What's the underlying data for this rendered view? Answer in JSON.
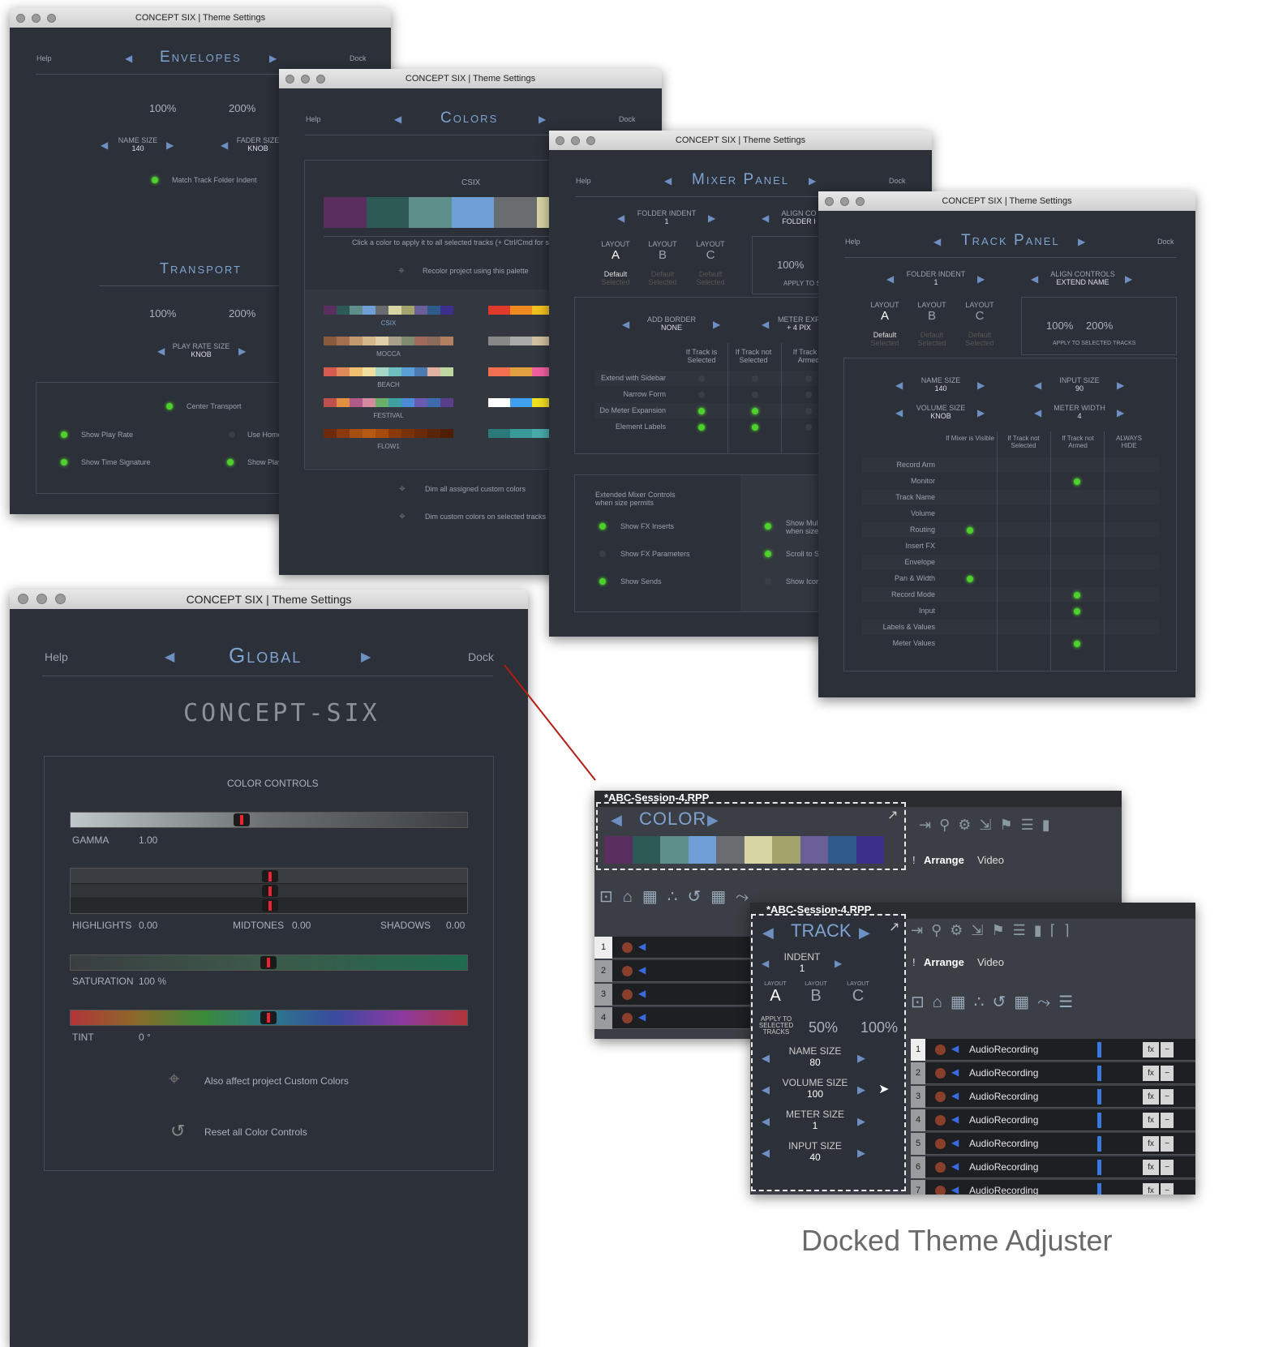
{
  "window_title": "CONCEPT SIX | Theme Settings",
  "common": {
    "help": "Help",
    "dock": "Dock",
    "prev": "◀",
    "next": "▶"
  },
  "envelopes": {
    "title": "Envelopes",
    "p100": "100%",
    "p200": "200%",
    "name_size_label": "NAME SIZE",
    "name_size_val": "140",
    "fader_size_label": "FADER SIZE",
    "fader_size_val": "KNOB",
    "match_track": "Match Track Folder Indent",
    "transport_title": "Transport",
    "t100": "100%",
    "t200": "200%",
    "play_rate_label": "PLAY RATE SIZE",
    "play_rate_val": "KNOB",
    "center_transport": "Center Transport",
    "show_play_rate": "Show Play Rate",
    "use_home": "Use Home",
    "show_time_sig": "Show Time Signature",
    "show_play": "Show Play"
  },
  "colors": {
    "title": "Colors",
    "palette_name": "CSIX",
    "palette": [
      "#5a2e5e",
      "#2e5a56",
      "#5e8f8a",
      "#6f9fd6",
      "#6a6d70",
      "#d6d5a3",
      "#a3a36c",
      "#6b5f9a"
    ],
    "click_hint": "Click a color to apply it to all selected tracks  (+ Ctrl/Cmd for se",
    "recolor": "Recolor project using this palette",
    "palettes": [
      {
        "name": "CSIX",
        "colors": [
          "#5a2e5e",
          "#2e5a56",
          "#5e8f8a",
          "#6f9fd6",
          "#6a6d70",
          "#d6d5a3",
          "#a3a36c",
          "#6b5f9a",
          "#2f5b8a",
          "#3a2f8a"
        ]
      },
      {
        "name": "MOCCA",
        "colors": [
          "#8a5a3e",
          "#a36f4f",
          "#c29a6e",
          "#d6b98a",
          "#e0cfa6",
          "#a8a08a",
          "#7f8a6e",
          "#a06a5a",
          "#8a6a5a",
          "#b08060"
        ]
      },
      {
        "name": "BEACH",
        "colors": [
          "#d65a4e",
          "#e08a5a",
          "#f0c070",
          "#f0e0a0",
          "#a6d6c6",
          "#6ec0c0",
          "#5aa0d6",
          "#4a7ab0",
          "#e0b0a0",
          "#c0d6a0"
        ]
      },
      {
        "name": "FESTIVAL",
        "colors": [
          "#c0504e",
          "#e0903e",
          "#b05a8a",
          "#d68aa0",
          "#6ab06a",
          "#3ea0a0",
          "#4a8ad6",
          "#6a5ab0",
          "#3e6ab0",
          "#5a3e8a"
        ]
      },
      {
        "name": "FLOW1",
        "colors": [
          "#6e2a0a",
          "#8a3a0e",
          "#a64e12",
          "#b65a14",
          "#a64a0e",
          "#8a3a0a",
          "#7a320a",
          "#6a2a08",
          "#5a2406",
          "#4e1e04"
        ]
      }
    ],
    "palettes_right": [
      [
        "#e03a2a",
        "#f08a20",
        "#f0c020",
        "#60c040",
        "#30a0d0",
        "#3060c0",
        "#8040c0",
        "#c04090"
      ],
      [
        "#888",
        "#aaa",
        "#d0c0a0",
        "#b0d0c0",
        "#c0a080",
        "#a0a0b0",
        "#909090",
        "#707070"
      ],
      [
        "#f07050",
        "#e0a040",
        "#f060a0",
        "#40c0c0",
        "#60e0a0",
        "#a0e040",
        "#4080e0",
        "#c050e0"
      ],
      [
        "#ffffff",
        "#40a0f0",
        "#f0e020",
        "#20c020",
        "#f040f0",
        "#2040f0",
        "#80f0f0",
        "#f08080"
      ],
      [
        "#2a7a7a",
        "#3a9a9a",
        "#4aaaaa",
        "#5abaaa",
        "#3a8a8a",
        "#2a6a6a",
        "#1a5a5a",
        "#0a4a4a"
      ]
    ],
    "dim_assigned": "Dim all assigned custom colors",
    "dim_selected": "Dim custom colors on selected tracks"
  },
  "mixer": {
    "title": "Mixer Panel",
    "folder_indent_label": "FOLDER INDENT",
    "folder_indent_val": "1",
    "align_label": "ALIGN CO",
    "align_val": "FOLDER I",
    "layout_label": "LAYOUT",
    "layouts": [
      "A",
      "B",
      "C"
    ],
    "default_lbl": "Default",
    "selected_lbl": "Selected",
    "p100": "100%",
    "apply": "APPLY TO S",
    "add_border_label": "ADD BORDER",
    "add_border_val": "NONE",
    "meter_exp_label": "METER EXP",
    "meter_exp_val": "+ 4 PIX",
    "col1": "If Track is Selected",
    "col2": "If Track not Selected",
    "col3": "If Track is Armed",
    "rows": [
      "Extend with Sidebar",
      "Narrow Form",
      "Do Meter Expansion",
      "Element Labels"
    ],
    "ext_title": "Extended Mixer Controls",
    "ext_sub": "when size permits",
    "show_fx_inserts": "Show FX Inserts",
    "show_fx_params": "Show FX Parameters",
    "show_sends": "Show Sends",
    "show_mul": "Show Mul",
    "show_mul2": "when size",
    "scroll_to": "Scroll to S",
    "show_icon": "Show Icon"
  },
  "trackp": {
    "title": "Track Panel",
    "folder_indent_label": "FOLDER INDENT",
    "folder_indent_val": "1",
    "align_label": "ALIGN CONTROLS",
    "align_val": "EXTEND NAME",
    "layout_label": "LAYOUT",
    "layouts": [
      "A",
      "B",
      "C"
    ],
    "default_lbl": "Default",
    "selected_lbl": "Selected",
    "p100": "100%",
    "p200": "200%",
    "apply": "APPLY TO SELECTED TRACKS",
    "name_size_label": "NAME SIZE",
    "name_size_val": "140",
    "input_size_label": "INPUT SIZE",
    "input_size_val": "90",
    "volume_size_label": "VOLUME SIZE",
    "volume_size_val": "KNOB",
    "meter_width_label": "METER WIDTH",
    "meter_width_val": "4",
    "col1": "If Mixer is Visible",
    "col2": "If Track not Selected",
    "col3": "If Track not Armed",
    "col4": "ALWAYS HIDE",
    "rows": [
      "Record Arm",
      "Monitor",
      "Track Name",
      "Volume",
      "Routing",
      "Insert FX",
      "Envelope",
      "Pan & Width",
      "Record Mode",
      "Input",
      "Labels & Values",
      "Meter Values"
    ]
  },
  "global": {
    "title": "Global",
    "brand": "CONCEPT-SIX",
    "color_controls": "COLOR CONTROLS",
    "gamma_label": "GAMMA",
    "gamma_val": "1.00",
    "highlights_label": "HIGHLIGHTS",
    "highlights_val": "0.00",
    "midtones_label": "MIDTONES",
    "midtones_val": "0.00",
    "shadows_label": "SHADOWS",
    "shadows_val": "0.00",
    "saturation_label": "SATURATION",
    "saturation_val": "100 %",
    "tint_label": "TINT",
    "tint_val": "0 °",
    "also_affect": "Also affect project Custom Colors",
    "reset": "Reset all Color Controls"
  },
  "reaper1": {
    "title": "*ABC-Session-4.RPP",
    "color_title": "COLOR",
    "palette": [
      "#5a2e5e",
      "#2e5a56",
      "#5e8f8a",
      "#6f9fd6",
      "#6a6d70",
      "#d6d5a3",
      "#a3a36c",
      "#6b5f9a",
      "#2f5b8a",
      "#3a2f8a"
    ],
    "arrange": "Arrange",
    "video": "Video",
    "bang": "!",
    "rows": [
      "1",
      "2",
      "3",
      "4"
    ]
  },
  "reaper2": {
    "title": "*ABC-Session-4.RPP",
    "track_title": "TRACK",
    "indent_label": "INDENT",
    "indent_val": "1",
    "layout_label": "LAYOUT",
    "layouts": [
      "A",
      "B",
      "C"
    ],
    "apply": "APPLY TO SELECTED TRACKS",
    "p50": "50%",
    "p100": "100%",
    "name_size_label": "NAME SIZE",
    "name_size_val": "80",
    "volume_size_label": "VOLUME SIZE",
    "volume_size_val": "100",
    "meter_size_label": "METER SIZE",
    "meter_size_val": "1",
    "input_size_label": "INPUT SIZE",
    "input_size_val": "40",
    "arrange": "Arrange",
    "video": "Video",
    "bang": "!",
    "track_name": "AudioRecording",
    "fx": "fx",
    "tracks": [
      "1",
      "2",
      "3",
      "4",
      "5",
      "6",
      "7"
    ]
  },
  "caption": "Docked Theme Adjuster"
}
